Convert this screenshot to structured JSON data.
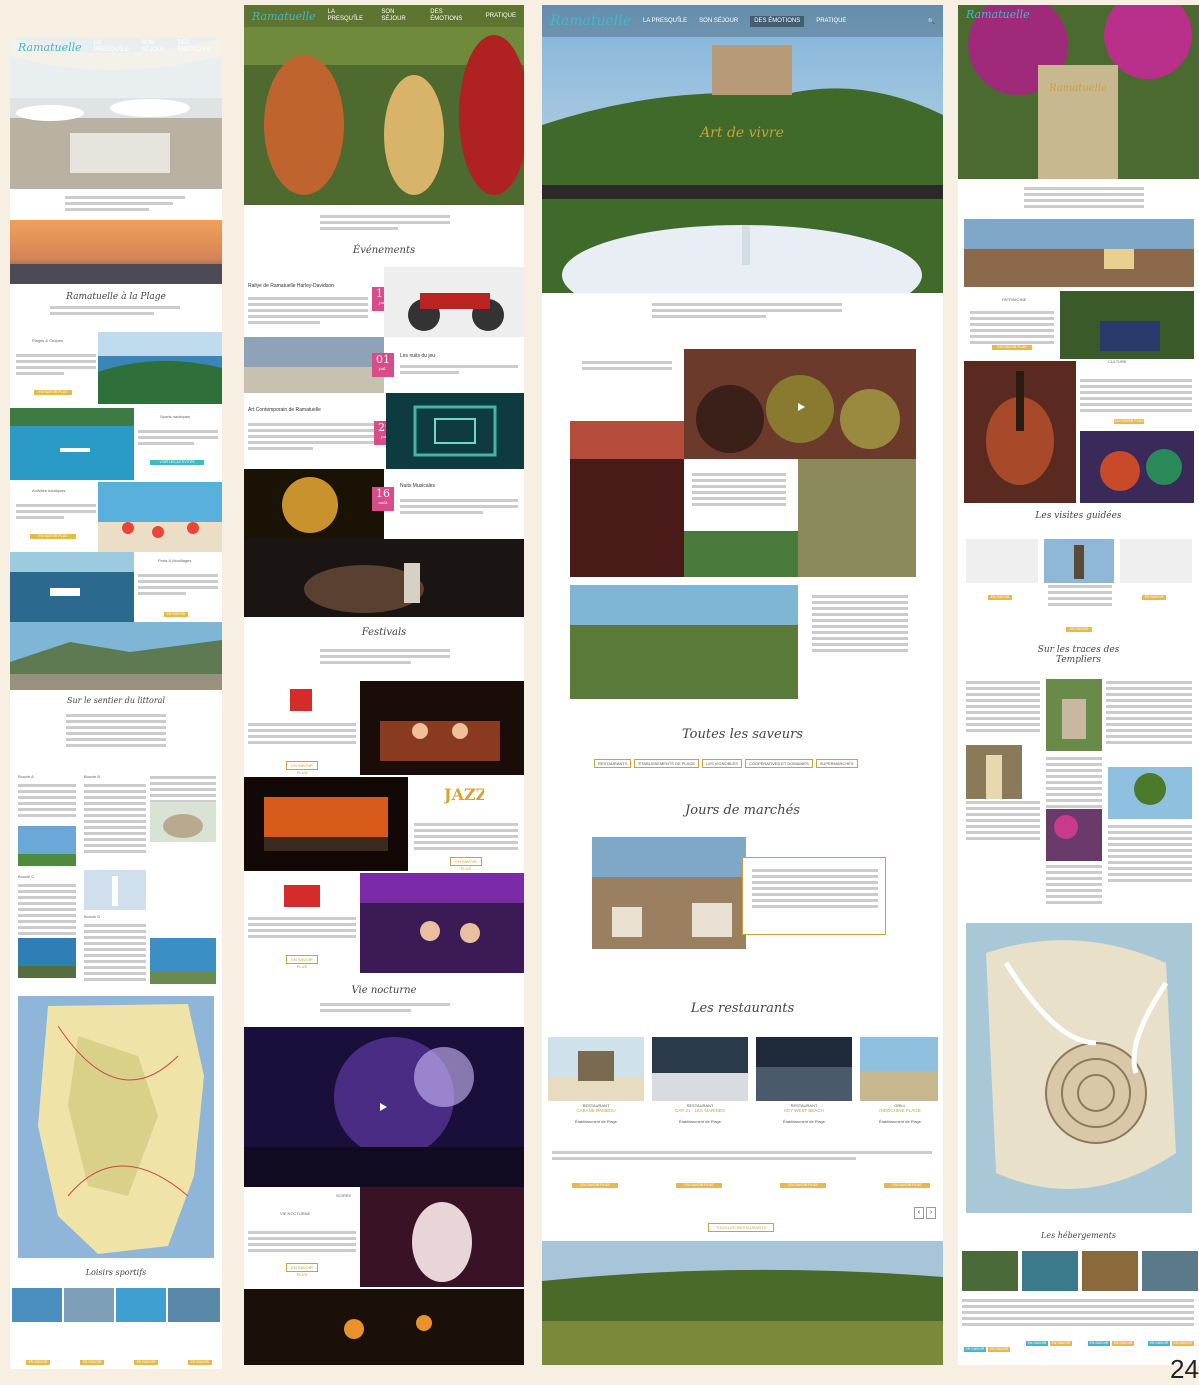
{
  "nav": {
    "logo": "Ramatuelle",
    "items": [
      "La presqu'île",
      "Son séjour",
      "Des émotions",
      "Pratique"
    ],
    "active_index": 2
  },
  "panel1": {
    "heading_main": "Ramatuelle",
    "heading_plage": "Ramatuelle à la Plage",
    "block_labels": [
      "Plages & Criques",
      "Sports nautiques",
      "Activités nautiques",
      "Ports & Mouillages"
    ],
    "heading_sentier": "Sur le sentier du littoral",
    "sections": [
      "Boucle A",
      "Boucle B",
      "Boucle C",
      "Boucle D"
    ],
    "heading_loisirs": "Loisirs sportifs"
  },
  "panel2": {
    "heading_events": "Événements",
    "events": [
      {
        "day": "11",
        "month": "juin",
        "title": "Rallye de Ramatuelle Harley-Davidson"
      },
      {
        "day": "01",
        "month": "juil.",
        "title": "Les nuits du jeu"
      },
      {
        "day": "29",
        "month": "juil.",
        "title": "Art Contemporain de Ramatuelle"
      },
      {
        "day": "16",
        "month": "août",
        "title": "Nuits Musicales"
      }
    ],
    "heading_festivals": "Festivals",
    "jazz_label": "JAZZ",
    "heading_nocturne": "Vie nocturne"
  },
  "panel3": {
    "heading_main": "Art de vivre",
    "heading_saveurs": "Toutes les saveurs",
    "tags": [
      "RESTAURANTS",
      "ÉTABLISSEMENTS DE PLAGE",
      "LES VIGNOBLES",
      "COOPÉRATIVES ET DOMAINES",
      "SUPERMARCHÉS"
    ],
    "heading_marches": "Jours de marchés",
    "heading_restaurants": "Les restaurants",
    "restaurants": [
      {
        "kind": "RESTAURANT",
        "name": "CABANE BAMBOU"
      },
      {
        "kind": "RESTAURANT",
        "name": "CAP 21 - LES MARINES"
      },
      {
        "kind": "RESTAURANT",
        "name": "KEY WEST BEACH"
      },
      {
        "kind": "GRILL",
        "name": "INDOCHINE PLAGE"
      }
    ],
    "restaurant_category": "Établissement de Plage"
  },
  "panel4": {
    "heading_main": "Ramatuelle",
    "heading_visites": "Les visites guidées",
    "heading_traces": "Sur les traces des Templiers",
    "heading_hebergements": "Les hébergements"
  },
  "page_number": "24"
}
